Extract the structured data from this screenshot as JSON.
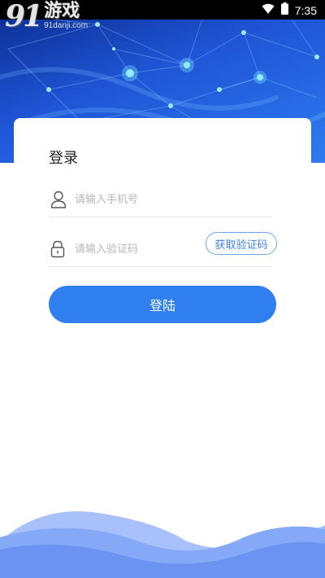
{
  "status_bar": {
    "time": "7:35",
    "wifi_icon": "wifi-icon",
    "battery_icon": "battery-icon"
  },
  "watermark": {
    "mark": "91",
    "name": "游戏",
    "url": "91danji.com"
  },
  "login": {
    "title": "登录",
    "phone_placeholder": "请输入手机号",
    "phone_icon": "user-icon",
    "code_placeholder": "请输入验证码",
    "code_icon": "lock-icon",
    "get_code_label": "获取验证码",
    "submit_label": "登陆"
  },
  "colors": {
    "accent": "#2f7ff0",
    "hero_dark": "#0a2a8c",
    "hero_light": "#2e7cf0",
    "wave": "#6b94f2"
  }
}
